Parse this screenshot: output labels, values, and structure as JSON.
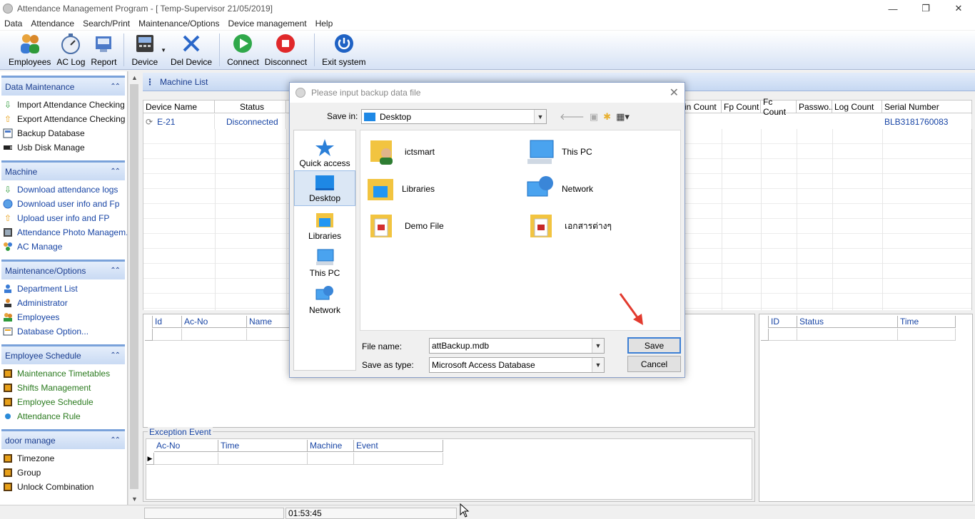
{
  "window": {
    "title": "Attendance Management Program - [ Temp-Supervisor 21/05/2019]",
    "min_glyph": "—",
    "restore_glyph": "❐",
    "close_glyph": "✕"
  },
  "menu": [
    "Data",
    "Attendance",
    "Search/Print",
    "Maintenance/Options",
    "Device management",
    "Help"
  ],
  "toolbar": {
    "employees": "Employees",
    "ac_log": "AC Log",
    "report": "Report",
    "device": "Device",
    "del_device": "Del Device",
    "connect": "Connect",
    "disconnect": "Disconnect",
    "exit_system": "Exit system"
  },
  "sidebar": {
    "data_maintenance": {
      "title": "Data Maintenance",
      "items": [
        "Import Attendance Checking ...",
        "Export Attendance Checking ...",
        "Backup Database",
        "Usb Disk Manage"
      ]
    },
    "machine": {
      "title": "Machine",
      "items": [
        "Download attendance logs",
        "Download user info and Fp",
        "Upload user info and FP",
        "Attendance Photo Managem...",
        "AC Manage"
      ]
    },
    "maintenance_options": {
      "title": "Maintenance/Options",
      "items": [
        "Department List",
        "Administrator",
        "Employees",
        "Database Option..."
      ]
    },
    "employee_schedule": {
      "title": "Employee Schedule",
      "items": [
        "Maintenance Timetables",
        "Shifts Management",
        "Employee Schedule",
        "Attendance Rule"
      ]
    },
    "door_manage": {
      "title": "door manage",
      "items": [
        "Timezone",
        "Group",
        "Unlock Combination"
      ]
    }
  },
  "machine_list": {
    "title": "Machine List",
    "columns": {
      "device_name": "Device Name",
      "status": "Status",
      "in_count": "in Count",
      "fp_count": "Fp Count",
      "fc_count": "Fc Count",
      "password": "Passwo...",
      "log_count": "Log Count",
      "serial_number": "Serial Number"
    },
    "row": {
      "device_name": "E-21",
      "status": "Disconnected",
      "serial_number": "BLB3181760083"
    }
  },
  "users_grid": {
    "columns": [
      "Id",
      "Ac-No",
      "Name"
    ]
  },
  "exception": {
    "label": "Exception Event",
    "columns": [
      "Ac-No",
      "Time",
      "Machine",
      "Event"
    ]
  },
  "right_grid": {
    "columns": [
      "ID",
      "Status",
      "Time"
    ]
  },
  "statusbar": {
    "time": "01:53:45"
  },
  "dialog": {
    "title": "Please input backup data file",
    "save_in_label": "Save in:",
    "save_in_value": "Desktop",
    "places": [
      "Quick access",
      "Desktop",
      "Libraries",
      "This PC",
      "Network"
    ],
    "files": [
      "ictsmart",
      "This PC",
      "Libraries",
      "Network",
      "Demo File",
      "เอกสารต่างๆ"
    ],
    "file_name_label": "File name:",
    "file_name_value": "attBackup.mdb",
    "save_type_label": "Save as type:",
    "save_type_value": "Microsoft Access Database",
    "save_button": "Save",
    "cancel_button": "Cancel"
  },
  "colors": {
    "link_blue": "#1845a5",
    "header_blue": "#1a3d8f",
    "group_border": "#7aa2da",
    "annotation_arrow": "#e23a2e"
  }
}
